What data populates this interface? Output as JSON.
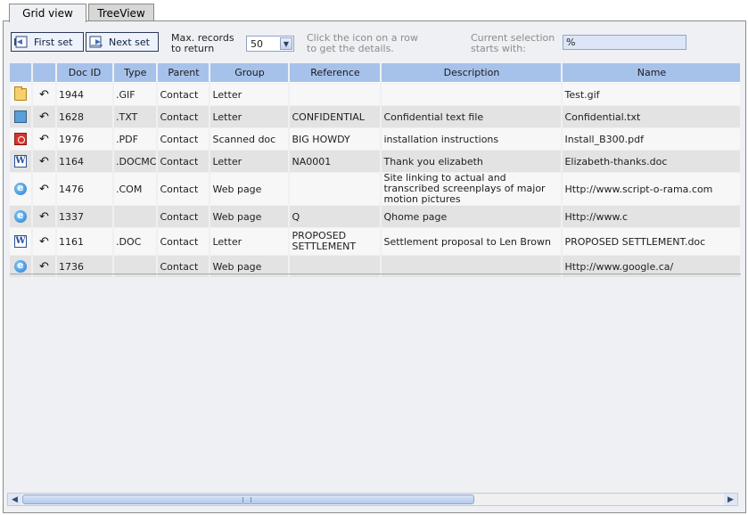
{
  "tabs": [
    {
      "label": "Grid view"
    },
    {
      "label": "TreeView"
    }
  ],
  "toolbar": {
    "first_set": "First set",
    "next_set": "Next set",
    "max_records_line1": "Max. records",
    "max_records_line2": "to return",
    "max_records_value": "50",
    "hint_line1": "Click the icon on a row",
    "hint_line2": "to get the details.",
    "selection_line1": "Current selection",
    "selection_line2": "starts with:",
    "selection_value": "%"
  },
  "grid": {
    "columns": [
      "",
      "",
      "Doc ID",
      "Type",
      "Parent",
      "Group",
      "Reference",
      "Description",
      "Name"
    ],
    "rows": [
      {
        "icon": "folder-icon",
        "docid": "1944",
        "type": ".GIF",
        "parent": "Contact",
        "group": "Letter",
        "reference": "",
        "description": "",
        "name": "Test.gif"
      },
      {
        "icon": "text-file-icon",
        "docid": "1628",
        "type": ".TXT",
        "parent": "Contact",
        "group": "Letter",
        "reference": "CONFIDENTIAL",
        "description": "Confidential text file",
        "name": "Confidential.txt"
      },
      {
        "icon": "pdf-icon",
        "docid": "1976",
        "type": ".PDF",
        "parent": "Contact",
        "group": "Scanned doc",
        "reference": "BIG HOWDY",
        "description": "installation instructions",
        "name": "Install_B300.pdf"
      },
      {
        "icon": "word-icon",
        "docid": "1164",
        "type": ".DOCMC",
        "parent": "Contact",
        "group": "Letter",
        "reference": "NA0001",
        "description": "Thank you elizabeth",
        "name": "Elizabeth-thanks.doc"
      },
      {
        "icon": "ie-icon",
        "docid": "1476",
        "type": ".COM",
        "parent": "Contact",
        "group": "Web page",
        "reference": "",
        "description": "Site linking to actual and transcribed screenplays of major motion pictures",
        "name": "Http://www.script-o-rama.com"
      },
      {
        "icon": "ie-icon",
        "docid": "1337",
        "type": "",
        "parent": "Contact",
        "group": "Web page",
        "reference": "Q",
        "description": "Qhome page",
        "name": "Http://www.c"
      },
      {
        "icon": "word-icon",
        "docid": "1161",
        "type": ".DOC",
        "parent": "Contact",
        "group": "Letter",
        "reference": "PROPOSED SETTLEMENT",
        "description": "Settlement proposal to Len Brown",
        "name": "PROPOSED SETTLEMENT.doc"
      },
      {
        "icon": "ie-icon",
        "docid": "1736",
        "type": "",
        "parent": "Contact",
        "group": "Web page",
        "reference": "",
        "description": "",
        "name": "Http://www.google.ca/"
      }
    ]
  }
}
